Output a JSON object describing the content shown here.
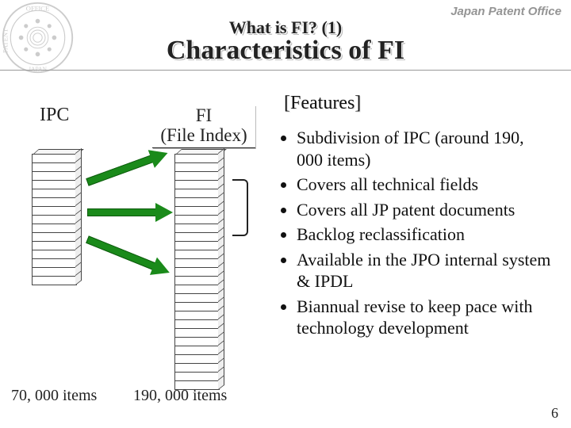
{
  "header": {
    "org": "Japan Patent Office",
    "title1": "What is FI? (1)",
    "title2": "Characteristics of FI",
    "seal_label": "JPO seal"
  },
  "diagram": {
    "ipc_label": "IPC",
    "fi_label_line1": "FI",
    "fi_label_line2": "(File Index)",
    "ipc_count": "70, 000 items",
    "fi_count": "190, 000 items",
    "ipc_segments": 15,
    "fi_segments": 27
  },
  "features": {
    "heading": "[Features]",
    "items": [
      "Subdivision of IPC (around 190, 000 items)",
      "Covers all technical fields",
      "Covers all JP patent documents",
      "Backlog reclassification",
      "Available in the JPO internal system & IPDL",
      "Biannual revise to keep pace with technology development"
    ]
  },
  "slide_number": "6"
}
